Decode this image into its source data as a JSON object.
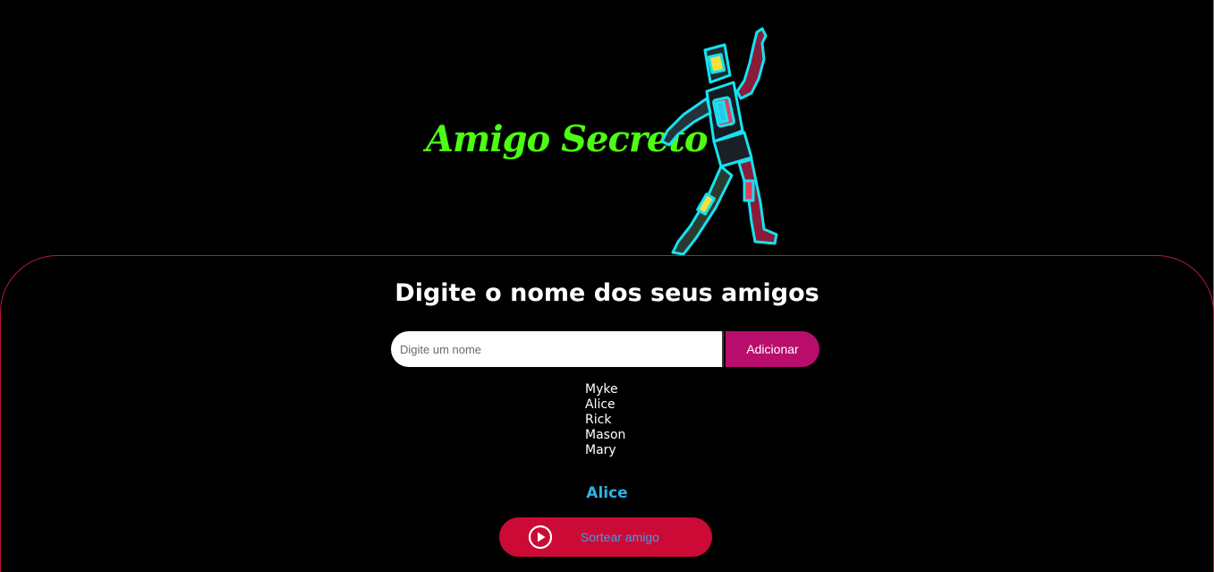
{
  "header": {
    "title": "Amigo Secreto",
    "robot_icon": "robot-illustration"
  },
  "main": {
    "heading": "Digite o nome dos seus amigos",
    "input": {
      "value": "",
      "placeholder": "Digite um nome"
    },
    "add_label": "Adicionar",
    "friends": [
      "Myke",
      "Alice",
      "Rick",
      "Mason",
      "Mary"
    ],
    "result": "Alice",
    "draw_label": "Sortear amigo",
    "draw_icon": "play-circle-icon"
  },
  "colors": {
    "title": "#4cff12",
    "add_button": "#b80d6b",
    "draw_button": "#cc0a36",
    "result": "#2bb3ea",
    "panel_border": "#b8173d"
  }
}
